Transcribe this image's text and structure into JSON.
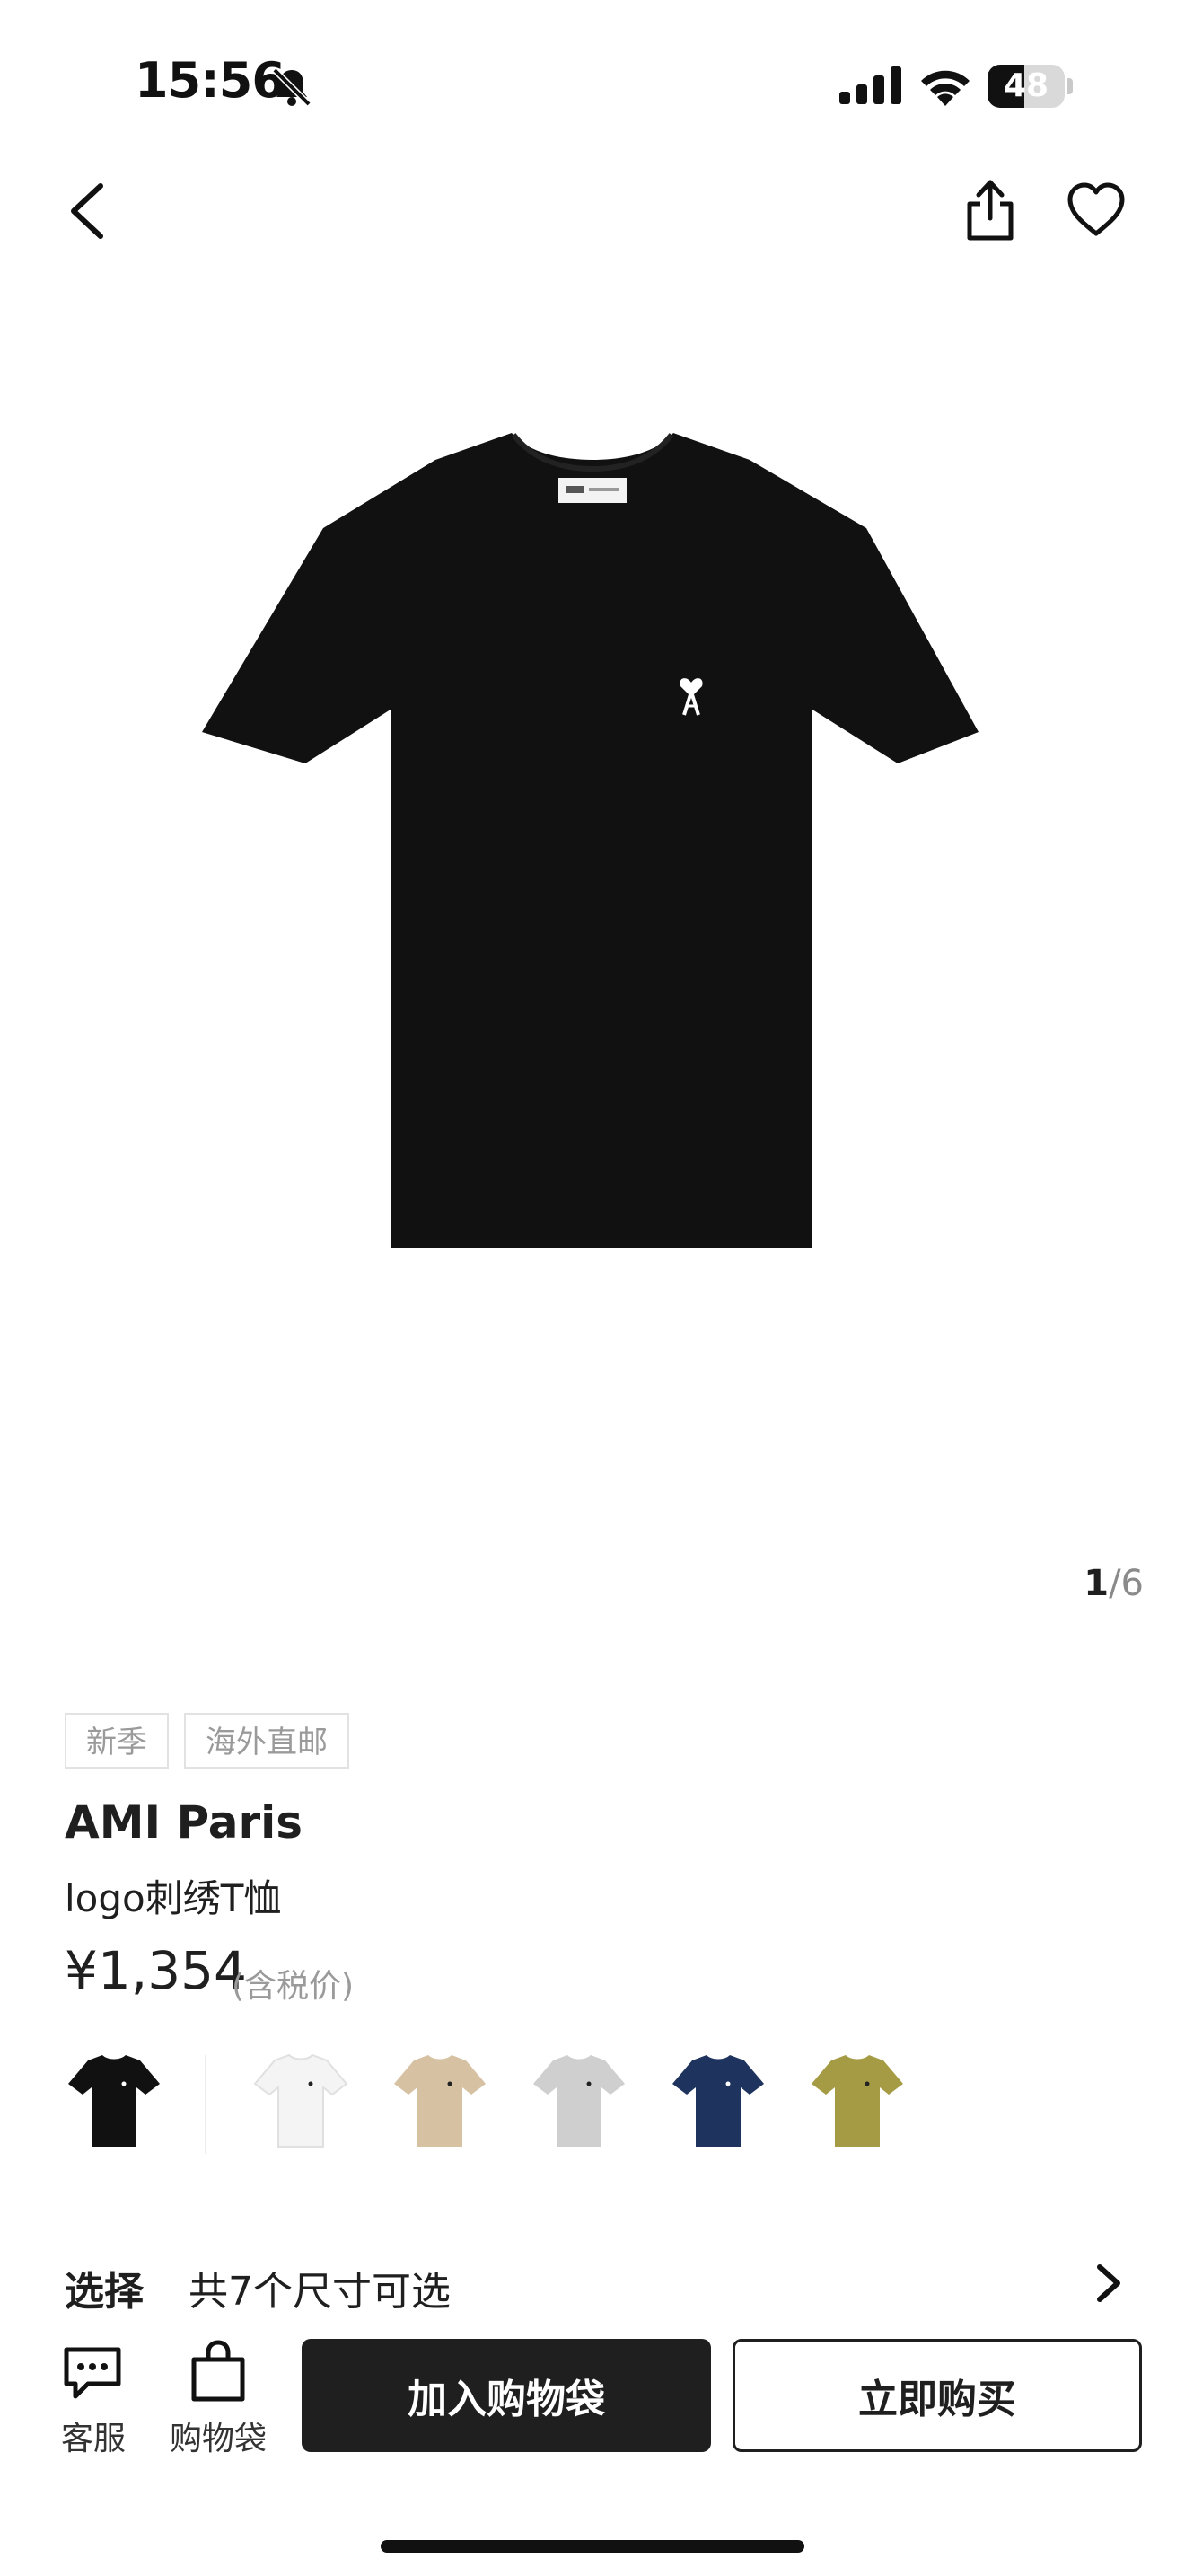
{
  "status_bar": {
    "time": "15:56",
    "battery": "48",
    "battery_level": 0.48
  },
  "gallery": {
    "current": "1",
    "separator": "/",
    "total": "6"
  },
  "product": {
    "tags": [
      "新季",
      "海外直邮"
    ],
    "brand": "AMI Paris",
    "name": "logo刺绣T恤",
    "price": "¥1,354",
    "price_note": "(含税价)",
    "swatches": [
      {
        "color": "#111111",
        "selected": true
      },
      {
        "color": "#f4f4f4",
        "selected": false
      },
      {
        "color": "#d6c1a3",
        "selected": false
      },
      {
        "color": "#cfcfcf",
        "selected": false
      },
      {
        "color": "#1e335e",
        "selected": false
      },
      {
        "color": "#a59b45",
        "selected": false
      }
    ]
  },
  "size": {
    "label": "选择",
    "text": "共7个尺寸可选"
  },
  "bottom_bar": {
    "customer_service": "客服",
    "bag": "购物袋",
    "add_to_bag": "加入购物袋",
    "buy_now": "立即购买"
  },
  "icons": [
    "bell-slash-icon",
    "cellular-icon",
    "wifi-icon",
    "battery-icon",
    "back-chevron-icon",
    "share-icon",
    "heart-icon",
    "chevron-right-icon",
    "chat-icon",
    "bag-icon"
  ]
}
